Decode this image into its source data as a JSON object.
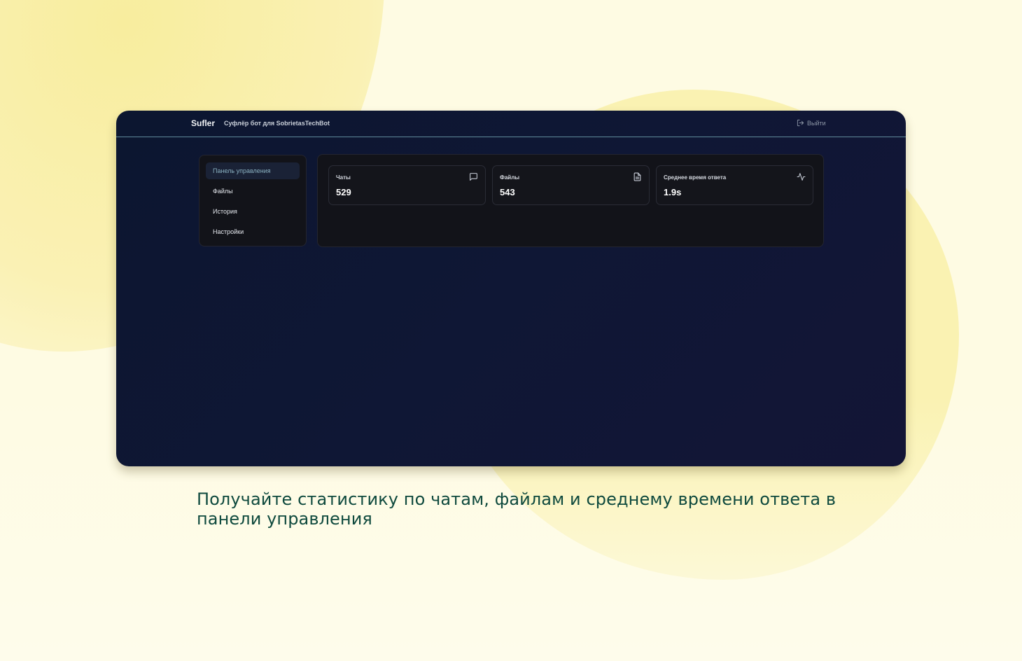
{
  "header": {
    "brand": "Sufler",
    "subtitle": "Суфлёр бот для SobrietasTechBot",
    "logout_label": "Выйти"
  },
  "sidebar": {
    "items": [
      {
        "label": "Панель управления",
        "active": true
      },
      {
        "label": "Файлы",
        "active": false
      },
      {
        "label": "История",
        "active": false
      },
      {
        "label": "Настройки",
        "active": false
      }
    ]
  },
  "stats": [
    {
      "label": "Чаты",
      "value": "529",
      "icon": "chat-icon"
    },
    {
      "label": "Файлы",
      "value": "543",
      "icon": "file-icon"
    },
    {
      "label": "Среднее время ответа",
      "value": "1.9s",
      "icon": "activity-icon"
    }
  ],
  "caption": "Получайте статистику по чатам, файлам и среднему времени ответа в панели управления",
  "colors": {
    "page_background": "#fefbe3",
    "window_background": "#0f1735",
    "accent_active": "#8ab1c0",
    "caption_text": "#0f4a3e"
  }
}
